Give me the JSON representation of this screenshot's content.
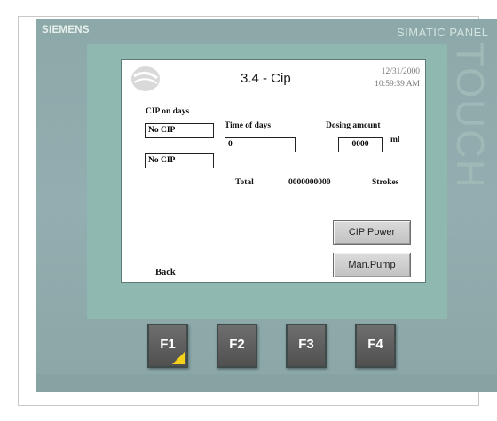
{
  "device": {
    "brand": "SIEMENS",
    "model": "SIMATIC PANEL",
    "touch_label": "TOUCH"
  },
  "screen": {
    "title": "3.4 - Cip",
    "date": "12/31/2000",
    "time": "10:59:39 AM",
    "cip_on_days_label": "CIP on days",
    "cip_field_1": "No CIP",
    "cip_field_2": "No CIP",
    "time_of_days_label": "Time of days",
    "time_of_days_value": "0",
    "dosing_amount_label": "Dosing amount",
    "dosing_amount_value": "0000",
    "dosing_unit": "ml",
    "total_label": "Total",
    "total_value": "0000000000",
    "strokes_label": "Strokes",
    "cip_power_button": "CIP Power",
    "man_pump_button": "Man.Pump",
    "back_label": "Back"
  },
  "function_keys": [
    "F1",
    "F2",
    "F3",
    "F4"
  ],
  "colors": {
    "bezel": "#8fb8b0",
    "casing": "#8ca8a8",
    "f1_indicator": "#f4d21c"
  }
}
